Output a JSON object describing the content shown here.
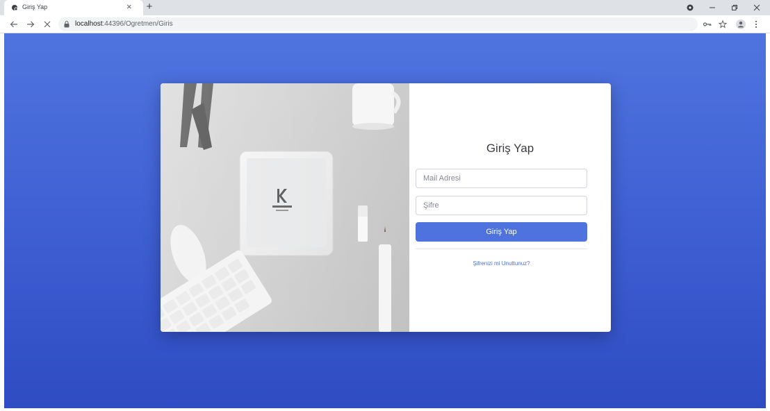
{
  "browser": {
    "tab_title": "Giriş Yap",
    "tab_close": "×",
    "new_tab": "+",
    "url_host": "localhost",
    "url_path": ":44396/Ogretmen/Giris"
  },
  "login": {
    "title": "Giriş Yap",
    "email_placeholder": "Mail Adresi",
    "password_placeholder": "Şifre",
    "submit_label": "Giriş Yap",
    "forgot_link": "Şifrenizi mi Unuttunuz?"
  },
  "colors": {
    "primary": "#4e73df",
    "background_top": "#4f74df",
    "background_bottom": "#2f4cc3"
  },
  "icons": {
    "tab_favicon": "loading-favicon-icon",
    "back": "arrow-left-icon",
    "forward": "arrow-right-icon",
    "stop": "close-icon",
    "lock": "lock-icon",
    "key": "key-icon",
    "star": "star-icon",
    "profile": "profile-icon",
    "menu": "kebab-menu-icon"
  }
}
